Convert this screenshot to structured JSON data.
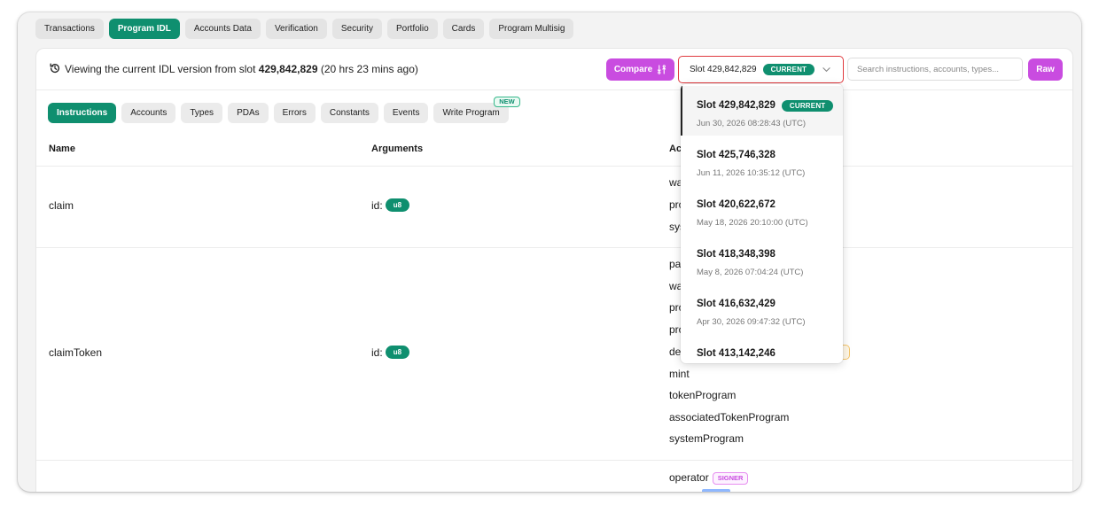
{
  "top_tabs": [
    "Transactions",
    "Program IDL",
    "Accounts Data",
    "Verification",
    "Security",
    "Portfolio",
    "Cards",
    "Program Multisig"
  ],
  "header": {
    "viewing_prefix": "Viewing the current IDL version from slot ",
    "viewing_slot": "429,842,829",
    "viewing_suffix": " (20 hrs 23 mins ago)",
    "compare_label": "Compare",
    "slot_select_label": "Slot 429,842,829",
    "current_badge": "CURRENT",
    "search_placeholder": "Search instructions, accounts, types...",
    "raw_label": "Raw"
  },
  "sub_tabs": [
    "Instructions",
    "Accounts",
    "Types",
    "PDAs",
    "Errors",
    "Constants",
    "Events",
    "Write Program"
  ],
  "new_badge": "NEW",
  "table": {
    "col_name": "Name",
    "col_arguments": "Arguments",
    "col_accounts": "Ac",
    "rows": [
      {
        "name": "claim",
        "arg_label": "id:",
        "arg_type": "u8",
        "accounts": [
          "wa",
          "pro",
          "sys"
        ]
      },
      {
        "name": "claimToken",
        "arg_label": "id:",
        "arg_type": "u8",
        "accounts": [
          "pa",
          "wa",
          "pro",
          "pro",
          "de",
          "mint",
          "tokenProgram",
          "associatedTokenProgram",
          "systemProgram"
        ]
      },
      {
        "name": "",
        "accounts": [
          "operator"
        ],
        "signer_badge": "SIGNER"
      }
    ]
  },
  "dropdown": [
    {
      "slot": "Slot 429,842,829",
      "date": "Jun 30, 2026 08:28:43 (UTC)",
      "current": "CURRENT"
    },
    {
      "slot": "Slot 425,746,328",
      "date": "Jun 11, 2026 10:35:12 (UTC)"
    },
    {
      "slot": "Slot 420,622,672",
      "date": "May 18, 2026 20:10:00 (UTC)"
    },
    {
      "slot": "Slot 418,348,398",
      "date": "May 8, 2026 07:04:24 (UTC)"
    },
    {
      "slot": "Slot 416,632,429",
      "date": "Apr 30, 2026 09:47:32 (UTC)"
    },
    {
      "slot": "Slot 413,142,246",
      "date": ""
    }
  ],
  "colors": {
    "accent_green": "#0f8f6f",
    "accent_purple": "#c94ce0",
    "select_border": "#e0393e"
  }
}
